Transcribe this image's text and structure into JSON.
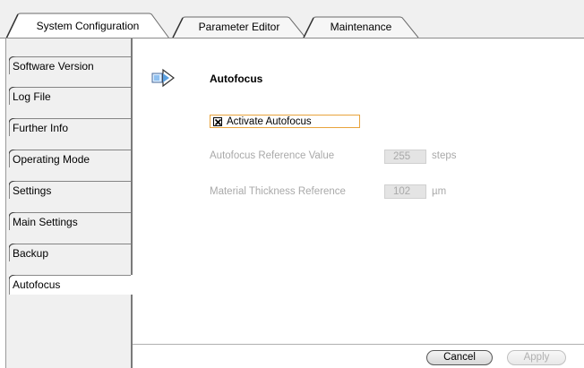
{
  "tabs": [
    {
      "label": "System Configuration",
      "active": true
    },
    {
      "label": "Parameter Editor",
      "active": false
    },
    {
      "label": "Maintenance",
      "active": false
    }
  ],
  "sidebar": {
    "items": [
      {
        "label": "Software Version"
      },
      {
        "label": "Log File"
      },
      {
        "label": "Further Info"
      },
      {
        "label": "Operating Mode"
      },
      {
        "label": "Settings"
      },
      {
        "label": "Main Settings"
      },
      {
        "label": "Backup"
      },
      {
        "label": "Autofocus",
        "active": true
      }
    ]
  },
  "main": {
    "title": "Autofocus",
    "header_icon": "autofocus-arrow-icon",
    "activate_checkbox": {
      "label": "Activate Autofocus",
      "checked": true
    },
    "params": [
      {
        "label": "Autofocus Reference Value",
        "value": "255",
        "unit": "steps",
        "enabled": false
      },
      {
        "label": "Material Thickness Reference",
        "value": "102",
        "unit": "µm",
        "enabled": false
      }
    ]
  },
  "buttons": {
    "cancel": "Cancel",
    "apply": "Apply"
  },
  "colors": {
    "focus_border": "#e8a33c",
    "disabled_text": "#a9a9a9",
    "panel_bg": "#f0f0f0"
  }
}
